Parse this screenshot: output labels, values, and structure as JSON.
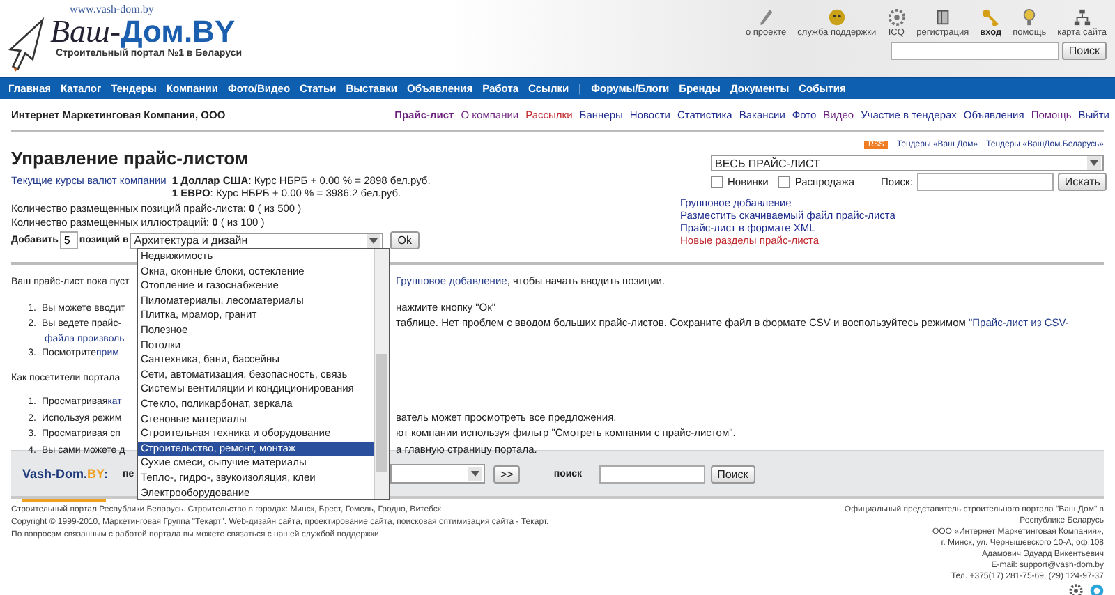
{
  "logo": {
    "url": "www.vash-dom.by",
    "name_a": "Ваш-",
    "name_b": "Дом.BY",
    "tagline": "Строительный портал №1 в Беларуси"
  },
  "top_links": [
    {
      "label": "о проекте",
      "selected": false
    },
    {
      "label": "служба поддержки",
      "selected": false
    },
    {
      "label": "ICQ",
      "selected": false
    },
    {
      "label": "регистрация",
      "selected": false
    },
    {
      "label": "вход",
      "selected": true
    },
    {
      "label": "помощь",
      "selected": false
    },
    {
      "label": "карта сайта",
      "selected": false
    }
  ],
  "top_search": {
    "button": "Поиск"
  },
  "nav": [
    {
      "kind": "link",
      "label": "Главная"
    },
    {
      "kind": "link",
      "label": "Каталог"
    },
    {
      "kind": "link",
      "label": "Тендеры"
    },
    {
      "kind": "link",
      "label": "Компании"
    },
    {
      "kind": "link",
      "label": "Фото/Видео"
    },
    {
      "kind": "link",
      "label": "Статьи"
    },
    {
      "kind": "link",
      "label": "Выставки"
    },
    {
      "kind": "link",
      "label": "Объявления"
    },
    {
      "kind": "link",
      "label": "Работа"
    },
    {
      "kind": "link",
      "label": "Ссылки"
    },
    {
      "kind": "separator",
      "label": "|"
    },
    {
      "kind": "link",
      "label": "Форумы/Блоги"
    },
    {
      "kind": "link",
      "label": "Бренды"
    },
    {
      "kind": "link",
      "label": "Документы"
    },
    {
      "kind": "link",
      "label": "События"
    }
  ],
  "company": "Интернет Маркетинговая Компания, ООО",
  "subnav": [
    {
      "label": "Прайс-лист",
      "selected": true,
      "color": "#6b1f7c"
    },
    {
      "label": "О компании",
      "selected": false,
      "color": "#6b1f7c"
    },
    {
      "label": "Рассылки",
      "selected": false,
      "color": "#c0282d"
    },
    {
      "label": "Баннеры",
      "selected": false,
      "color": "#1b2a8c"
    },
    {
      "label": "Новости",
      "selected": false,
      "color": "#1b2a8c"
    },
    {
      "label": "Статистика",
      "selected": false,
      "color": "#1b2a8c"
    },
    {
      "label": "Вакансии",
      "selected": false,
      "color": "#1b2a8c"
    },
    {
      "label": "Фото",
      "selected": false,
      "color": "#1b2a8c"
    },
    {
      "label": "Видео",
      "selected": false,
      "color": "#6b1f7c"
    },
    {
      "label": "Участие в тендерах",
      "selected": false,
      "color": "#1b2a8c"
    },
    {
      "label": "Объявления",
      "selected": false,
      "color": "#1b2a8c"
    },
    {
      "label": "Помощь",
      "selected": false,
      "color": "#6b1f7c"
    },
    {
      "label": "Выйти",
      "selected": false,
      "color": "#1b2a8c"
    }
  ],
  "title": "Управление прайс-листом",
  "rates_label": "Текущие курсы валют компании",
  "rates": [
    "**1 Доллар США**: Курс НБРБ + 0.00 % = 2898 бел.руб.",
    "**1 ЕВРО**: Курс НБРБ + 0.00 % = 3986.2 бел.руб."
  ],
  "counts": [
    "Количество размещенных позиций прайс-листа: **0** ( из 500 )",
    "Количество размещенных иллюстраций: **0** ( из 100 )"
  ],
  "add": {
    "label_a": "Добавить",
    "count": "5",
    "label_b": "позиций в",
    "category": "Архитектура и дизайн",
    "button": "Ok",
    "options": [
      {
        "label": "Недвижимость",
        "selected": false
      },
      {
        "label": "Окна, оконные блоки, остекление",
        "selected": false
      },
      {
        "label": "Отопление и газоснабжение",
        "selected": false
      },
      {
        "label": "Пиломатериалы, лесоматериалы",
        "selected": false
      },
      {
        "label": "Плитка, мрамор, гранит",
        "selected": false
      },
      {
        "label": "Полезное",
        "selected": false
      },
      {
        "label": "Потолки",
        "selected": false
      },
      {
        "label": "Сантехника, бани, бассейны",
        "selected": false
      },
      {
        "label": "Сети, автоматизация, безопасность, связь",
        "selected": false
      },
      {
        "label": "Системы вентиляции и кондиционирования",
        "selected": false
      },
      {
        "label": "Стекло, поликарбонат, зеркала",
        "selected": false
      },
      {
        "label": "Стеновые материалы",
        "selected": false
      },
      {
        "label": "Строительная техника и оборудование",
        "selected": false
      },
      {
        "label": "Строительство, ремонт, монтаж",
        "selected": true
      },
      {
        "label": "Сухие смеси, сыпучие материалы",
        "selected": false
      },
      {
        "label": "Тепло-, гидро-, звукоизоляция, клеи",
        "selected": false
      },
      {
        "label": "Электрооборудование",
        "selected": false
      }
    ]
  },
  "feeds": {
    "rss": "RSS",
    "links": [
      "Тендеры «Ваш Дом»",
      "Тендеры «ВашДом.Беларусь»"
    ]
  },
  "filter": {
    "scope": "ВЕСЬ ПРАЙС-ЛИСТ",
    "checks": [
      {
        "label": "Новинки",
        "checked": false
      },
      {
        "label": "Распродажа",
        "checked": false
      }
    ],
    "search_label": "Поиск:",
    "button": "Искать"
  },
  "actions": [
    {
      "label": "Групповое добавление",
      "color": "#1b2a8c"
    },
    {
      "label": "Разместить скачиваемый файл прайс-листа",
      "color": "#1b2a8c"
    },
    {
      "label": "Прайс-лист в формате XML",
      "color": "#1b2a8c"
    },
    {
      "label": "Новые разделы прайс-листа",
      "color": "#c0282d"
    }
  ],
  "blocks": [
    [
      {
        "kind": "text",
        "left": [
          {
            "text": "Ваш прайс-лист пока пуст",
            "link": false
          }
        ],
        "right": [
          {
            "text": "Групповое добавление",
            "link": true
          },
          {
            "text": ", чтобы начать вводить позиции.",
            "link": false
          }
        ]
      }
    ],
    [
      {
        "kind": "item",
        "num": "1.",
        "left": [
          {
            "text": "Вы можете вводит",
            "link": false
          }
        ],
        "right": [
          {
            "text": "нажмите кнопку \"Ок\"",
            "link": false
          }
        ]
      },
      {
        "kind": "item",
        "num": "2.",
        "left": [
          {
            "text": "Вы ведете прайс-",
            "link": false
          }
        ],
        "right": [
          {
            "text": "таблице. Нет проблем с вводом больших прайс-листов. Сохраните файл в формате CSV и воспользуйтесь режимом ",
            "link": false
          },
          {
            "text": "\"Прайс-лист из CSV-",
            "link": true
          }
        ]
      },
      {
        "kind": "continuation",
        "left": [
          {
            "text": "файла произволь",
            "link": true
          }
        ]
      },
      {
        "kind": "item",
        "num": "3.",
        "left": [
          {
            "text": "Посмотрите ",
            "link": false
          },
          {
            "text": "прим",
            "link": true
          }
        ]
      }
    ],
    [
      {
        "kind": "text",
        "left": [
          {
            "text": "Как посетители портала",
            "link": false
          }
        ]
      }
    ],
    [
      {
        "kind": "item",
        "num": "1.",
        "left": [
          {
            "text": "Просматривая ",
            "link": false
          },
          {
            "text": "кат",
            "link": true
          }
        ]
      },
      {
        "kind": "item",
        "num": "2.",
        "left": [
          {
            "text": "Используя режим",
            "link": false
          }
        ],
        "right": [
          {
            "text": "ватель может просмотреть все предложения.",
            "link": false
          }
        ]
      },
      {
        "kind": "item",
        "num": "3.",
        "left": [
          {
            "text": "Просматривая сп",
            "link": false
          }
        ],
        "right": [
          {
            "text": "ют компании используя фильтр \"Смотреть компании с прайс-листом\".",
            "link": false
          }
        ]
      },
      {
        "kind": "item",
        "num": "4.",
        "left": [
          {
            "text": "Вы сами можете д",
            "link": false
          }
        ],
        "right": [
          {
            "text": "а главную страницу портала.",
            "link": false
          }
        ]
      }
    ]
  ],
  "bottom_bar": {
    "brand_main": "Vash-Dom.",
    "brand_accent": "BY",
    "brand_suffix": ":",
    "cut_label": "пе",
    "go_button": ">>",
    "search_label": "поиск",
    "search_button": "Поиск"
  },
  "footer_left": [
    "Строительный портал Республики Беларусь. Строительство в городах: Минск, Брест, Гомель, Гродно, Витебск",
    "Copyright © 1999-2010, Маркетинговая Группа \"Текарт\". Web-дизайн сайта, проектирование сайта, поисковая оптимизация сайта - Текарт.",
    "По вопросам связанным с работой портала вы можете связаться с нашей службой поддержки"
  ],
  "footer_right": [
    "Официальный представитель строительного портала \"Ваш Дом\" в",
    "Республике Беларусь",
    "ООО «Интернет Маркетинговая Компания»,",
    "г. Минск, ул. Чернышевского 10-А, оф.108",
    "Адамович Эдуард Викентьевич",
    "E-mail: support@vash-dom.by",
    "Тел. +375(17) 281-75-69, (29) 124-97-37"
  ]
}
